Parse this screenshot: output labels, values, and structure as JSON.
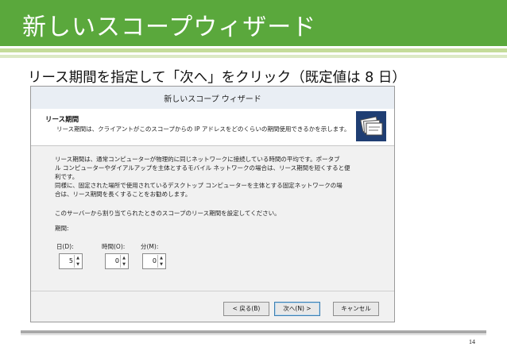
{
  "slide": {
    "title": "新しいスコープウィザード",
    "subtitle": "リース期間を指定して「次へ」をクリック（既定値は 8 日）",
    "page_number": "14",
    "accent_color": "#5aa83c"
  },
  "dialog": {
    "title": "新しいスコープ ウィザード",
    "header": {
      "title": "リース期間",
      "description": "リース期間は、クライアントがこのスコープからの IP アドレスをどのくらいの期間使用できるかを示します。",
      "icon": "scope-wizard-icon"
    },
    "body": {
      "line1": "リース期間は、通常コンピューターが物理的に同じネットワークに接続している時間の平均です。ポータブ",
      "line2": "ル コンピューターやダイアルアップを主体とするモバイル ネットワークの場合は、リース期間を短くすると便",
      "line3": "利です。",
      "line4": "同様に、固定された場所で使用されているデスクトップ コンピューターを主体とする固定ネットワークの場",
      "line5": "合は、リース期間を長くすることをお勧めします。",
      "instruction": "このサーバーから割り当てられたときのスコープのリース期間を設定してください。",
      "period_label": "期間:"
    },
    "fields": {
      "days": {
        "label": "日(D):",
        "value": "5"
      },
      "hours": {
        "label": "時間(O):",
        "value": "0"
      },
      "minutes": {
        "label": "分(M):",
        "value": "0"
      }
    },
    "buttons": {
      "back": "< 戻る(B)",
      "next": "次へ(N) >",
      "cancel": "キャンセル"
    }
  }
}
